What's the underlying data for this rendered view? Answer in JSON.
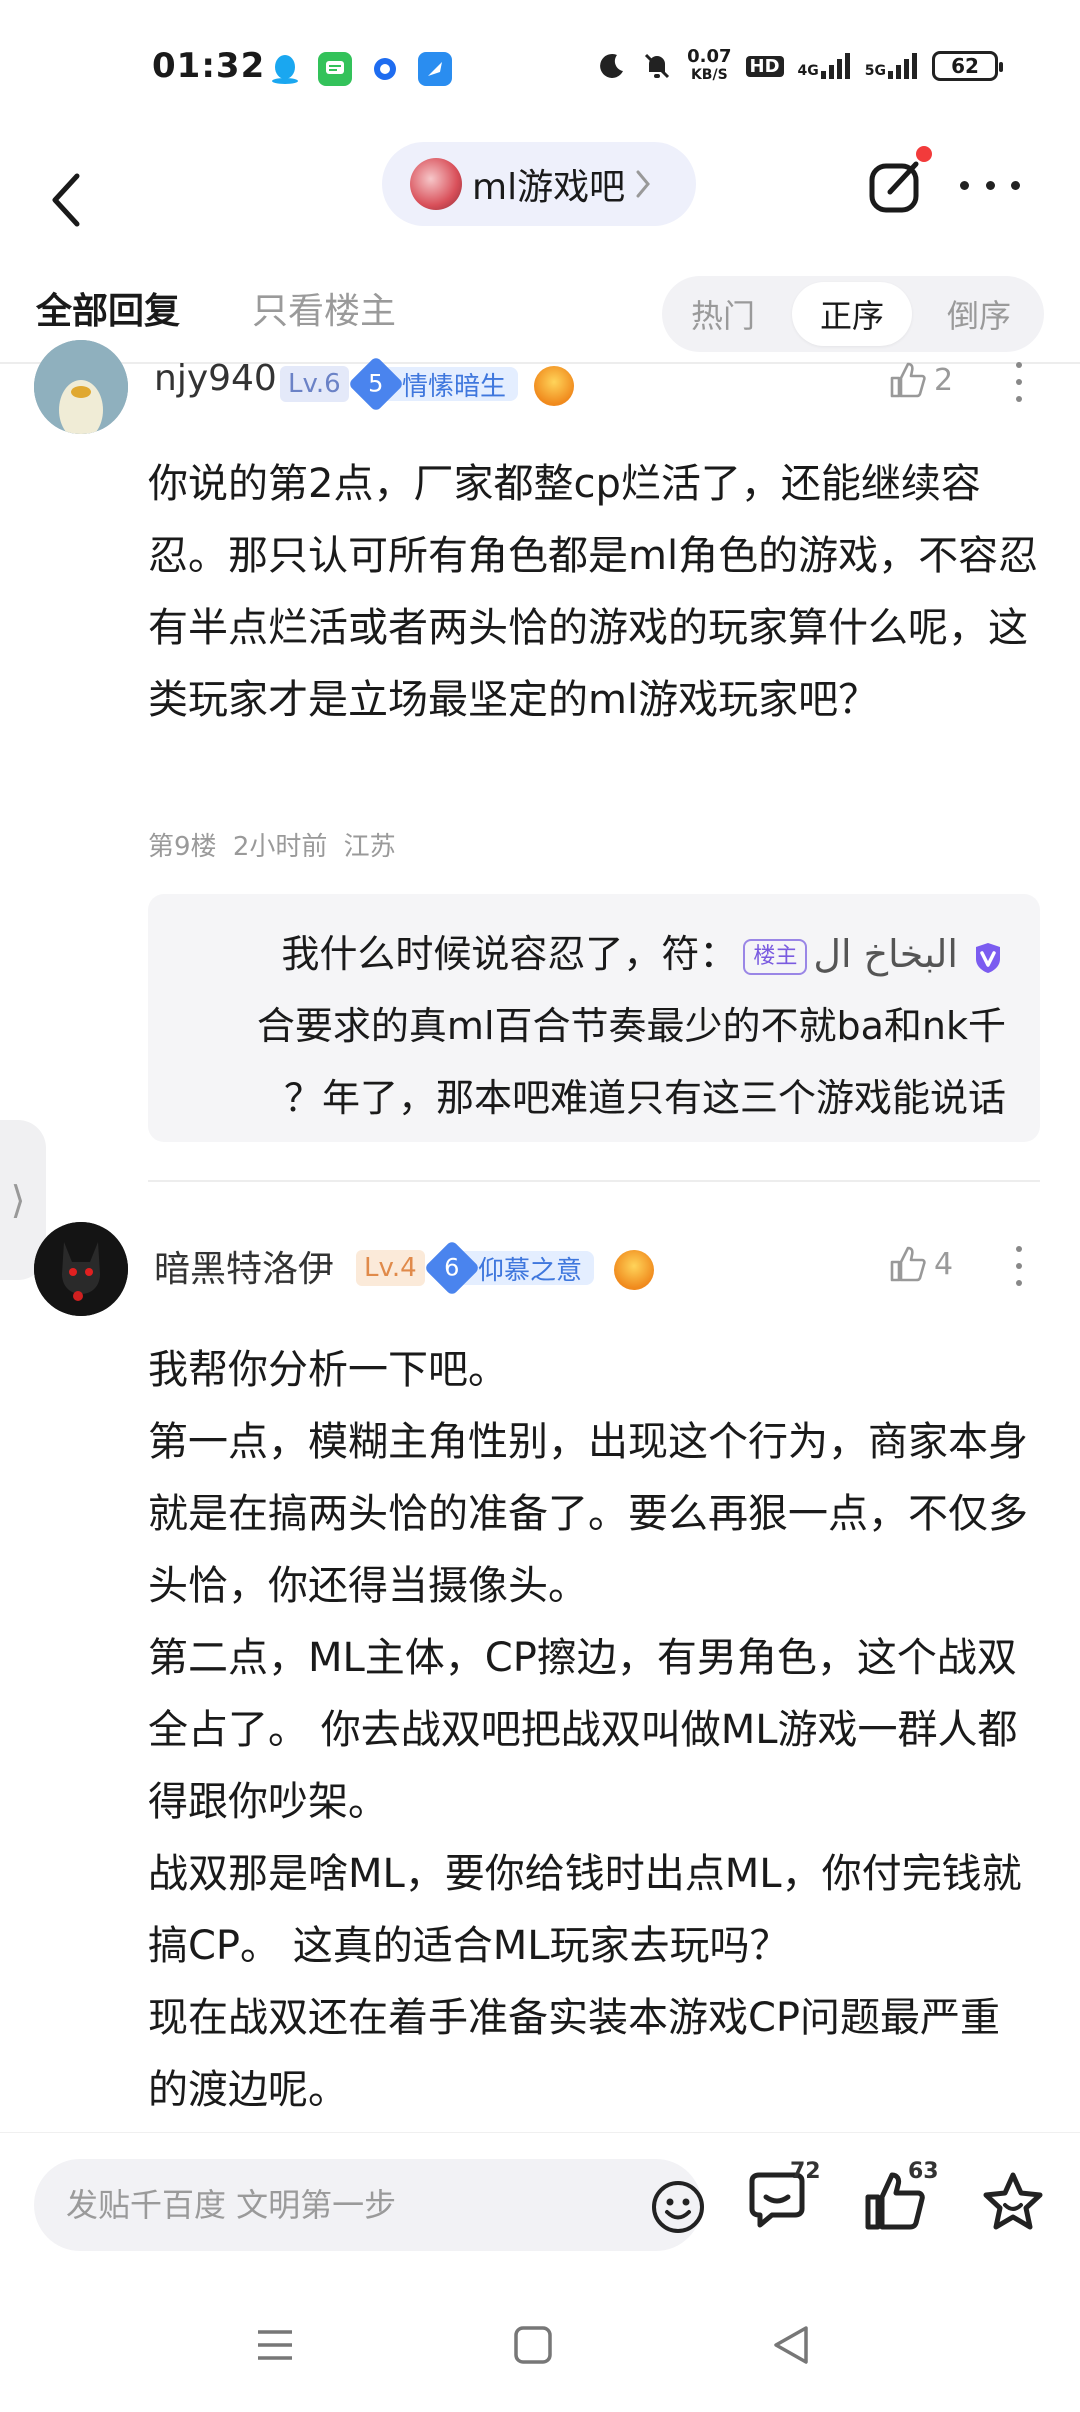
{
  "status_bar": {
    "time": "01:32",
    "speed_value": "0.07",
    "speed_unit": "KB/S",
    "hd_label": "HD",
    "net_4g": "4G",
    "net_5g": "5G",
    "battery": "62"
  },
  "header": {
    "forum_name": "ml游戏吧"
  },
  "tabs": {
    "all": "全部回复",
    "host_only": "只看楼主",
    "sort_hot": "热门",
    "sort_seq": "正序",
    "sort_rev": "倒序"
  },
  "posts": [
    {
      "username": "njy940",
      "level": "Lv.6",
      "badge_num": "5",
      "badge_text": "情愫暗生",
      "likes": "2",
      "content": "你说的第2点，厂家都整cp烂活了，还能继续容忍。那只认可所有角色都是ml角色的游戏，不容忍有半点烂活或者两头恰的游戏的玩家算什么呢，这类玩家才是立场最坚定的ml游戏玩家吧？",
      "floor": "第9楼",
      "time": "2小时前",
      "location": "江苏",
      "reply": {
        "author": "البخاخ ال",
        "host_tag": "楼主",
        "text": "我什么时候说容忍了，符合要求的真ml百合节奏最少的不就ba和nk千？年了，那本吧难道只有这三个游戏能说话",
        "text_line1": "我什么时候说容忍了，符：",
        "text_line2": "合要求的真ml百合节奏最少的不就ba和nk千",
        "text_line3": "？年了，那本吧难道只有这三个游戏能说话"
      }
    },
    {
      "username": "暗黑特洛伊",
      "level": "Lv.4",
      "badge_num": "6",
      "badge_text": "仰慕之意",
      "likes": "4",
      "content_lines": [
        "我帮你分析一下吧。",
        "第一点，模糊主角性别，出现这个行为，商家本身就是在搞两头恰的准备了。要么再狠一点，不仅多头恰，你还得当摄像头。",
        "第二点，ML主体，CP擦边，有男角色，这个战双全占了。 你去战双吧把战双叫做ML游戏一群人都得跟你吵架。",
        "战双那是啥ML，要你给钱时出点ML，你付完钱就搞CP。 这真的适合ML玩家去玩吗？",
        "现在战双还在着手准备实装本游戏CP问题最严重的渡边呢。"
      ]
    }
  ],
  "bottom_bar": {
    "input_placeholder": "发贴千百度 文明第一步",
    "comment_count": "72",
    "like_count": "63"
  },
  "side_tab_glyph": "⟩"
}
